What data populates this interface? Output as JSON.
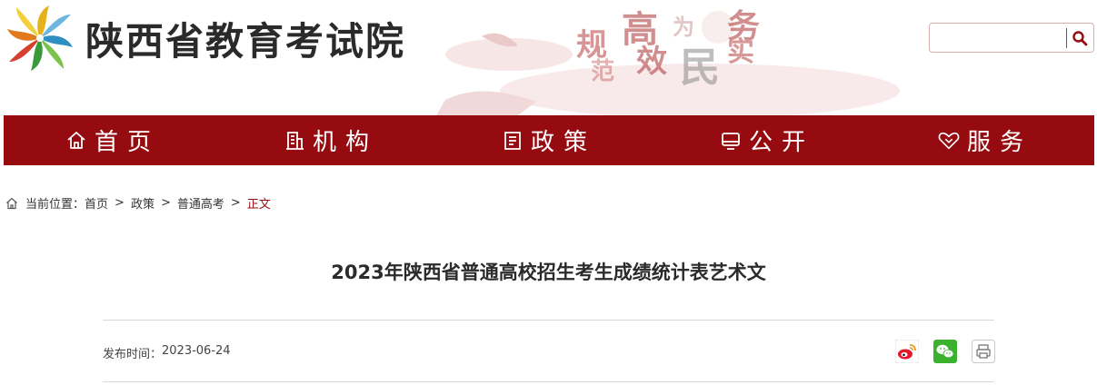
{
  "header": {
    "site_name": "陕西省教育考试院",
    "slogan_chars": [
      "规",
      "范",
      "高",
      "效",
      "为",
      "民",
      "务",
      "实"
    ],
    "brand_color": "#950b10",
    "logo": "pinwheel-logo-icon"
  },
  "search": {
    "placeholder": "",
    "value": "",
    "button_icon": "search-icon"
  },
  "nav": {
    "items": [
      {
        "label": "首页",
        "icon": "home-icon"
      },
      {
        "label": "机构",
        "icon": "building-icon"
      },
      {
        "label": "政策",
        "icon": "document-icon"
      },
      {
        "label": "公开",
        "icon": "monitor-icon"
      },
      {
        "label": "服务",
        "icon": "heart-hands-icon"
      }
    ]
  },
  "breadcrumb": {
    "prefix": "当前位置：",
    "items": [
      "首页",
      "政策",
      "普通高考",
      "正文"
    ],
    "separator": ">"
  },
  "article": {
    "title": "2023年陕西省普通高校招生考生成绩统计表艺术文",
    "publish_label": "发布时间：",
    "publish_date": "2023-06-24"
  },
  "share": {
    "buttons": [
      "weibo-icon",
      "wechat-icon",
      "print-icon"
    ]
  }
}
